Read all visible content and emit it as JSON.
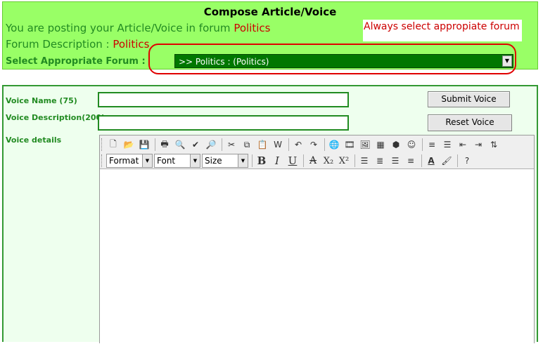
{
  "header": {
    "title": "Compose Article/Voice",
    "posting_prefix": "You are posting your Article/Voice in forum ",
    "posting_forum": "Politics",
    "desc_prefix": "Forum Description : ",
    "desc_value": "Politics",
    "note": "Always select appropiate forum",
    "forum_label": "Select Appropriate Forum :",
    "forum_selected": ">> Politics : (Politics)"
  },
  "form": {
    "voice_name_label": "Voice Name (75)",
    "voice_name_value": "",
    "voice_desc_label": "Voice Description(200)",
    "voice_desc_value": "",
    "voice_details_label": "Voice details",
    "submit_label": "Submit Voice",
    "reset_label": "Reset Voice"
  },
  "editor": {
    "format_label": "Format",
    "font_label": "Font",
    "size_label": "Size"
  },
  "colors": {
    "header_bg": "#99ff66",
    "form_bg": "#eeffee",
    "accent_green": "#228b22",
    "select_bg": "#007700",
    "highlight_red": "#e00000"
  }
}
